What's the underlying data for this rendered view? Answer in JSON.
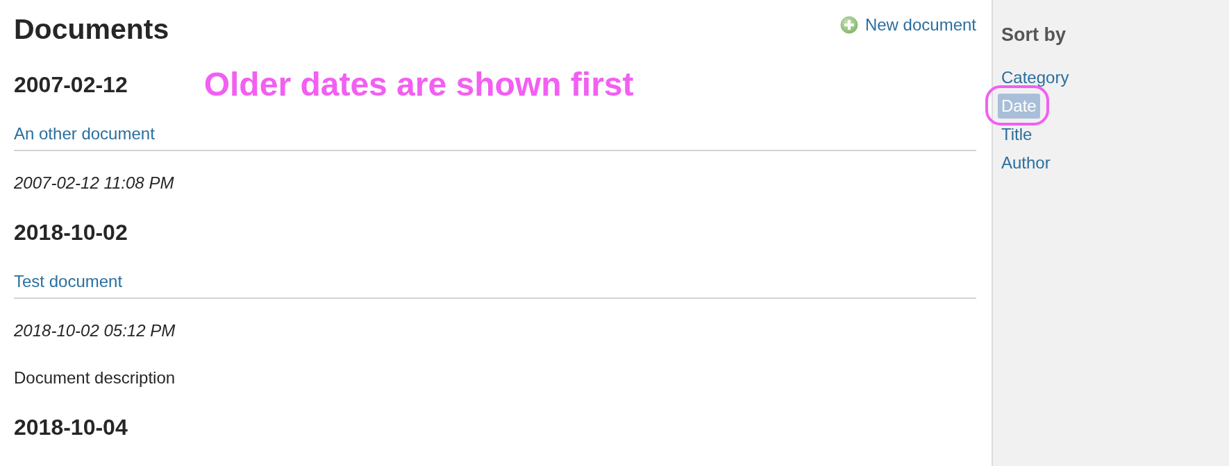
{
  "title": "Documents",
  "new_document": {
    "label": "New document"
  },
  "annotation": "Older dates are shown first",
  "groups": [
    {
      "date": "2007-02-12",
      "documents": [
        {
          "title": "An other document",
          "timestamp": "2007-02-12 11:08 PM"
        }
      ]
    },
    {
      "date": "2018-10-02",
      "documents": [
        {
          "title": "Test document",
          "timestamp": "2018-10-02 05:12 PM",
          "description": "Document description"
        }
      ]
    },
    {
      "date": "2018-10-04"
    }
  ],
  "sidebar": {
    "heading": "Sort by",
    "options": [
      {
        "label": "Category",
        "selected": false
      },
      {
        "label": "Date",
        "selected": true
      },
      {
        "label": "Title",
        "selected": false
      },
      {
        "label": "Author",
        "selected": false
      }
    ]
  }
}
